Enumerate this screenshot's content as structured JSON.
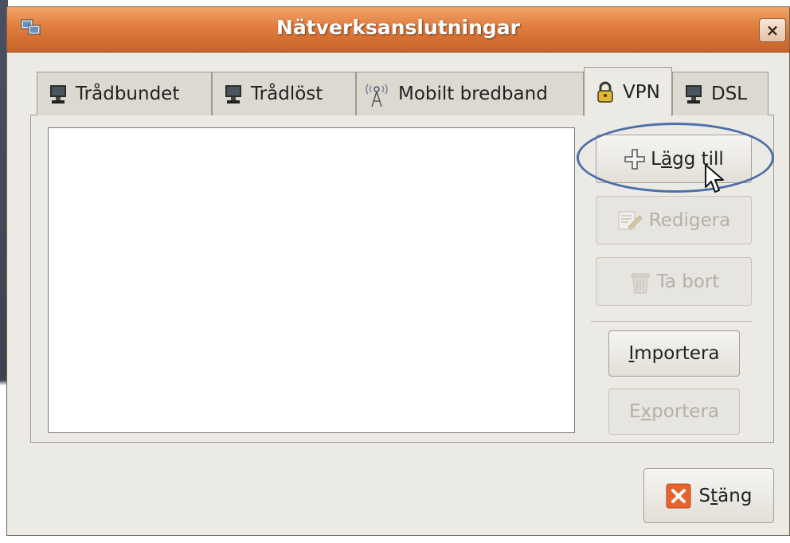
{
  "window": {
    "title": "Nätverksanslutningar",
    "close_label": "×"
  },
  "tabs": [
    {
      "label": "Trådbundet",
      "icon": "monitor-icon",
      "active": false
    },
    {
      "label": "Trådlöst",
      "icon": "monitor-icon",
      "active": false
    },
    {
      "label": "Mobilt bredband",
      "icon": "antenna-icon",
      "active": false
    },
    {
      "label": "VPN",
      "icon": "lock-icon",
      "active": true
    },
    {
      "label": "DSL",
      "icon": "monitor-icon",
      "active": false
    }
  ],
  "buttons": {
    "add": {
      "prefix": "L",
      "accel": "ä",
      "rest": "gg till",
      "icon": "plus-icon",
      "enabled": true
    },
    "edit": {
      "label": "Redigera",
      "icon": "edit-icon",
      "enabled": false
    },
    "delete": {
      "label": "Ta bort",
      "icon": "trash-icon",
      "enabled": false
    },
    "import": {
      "accel": "I",
      "rest": "mportera",
      "enabled": true
    },
    "export": {
      "prefix": "E",
      "accel": "x",
      "rest": "portera",
      "enabled": false
    },
    "close": {
      "prefix": "S",
      "accel": "t",
      "rest": "äng",
      "icon": "close-x-icon",
      "enabled": true
    }
  },
  "colors": {
    "titlebar": "#df7c3e",
    "window_bg": "#eceae4",
    "highlight_ring": "#4d6fa9",
    "close_icon": "#e8622a"
  }
}
